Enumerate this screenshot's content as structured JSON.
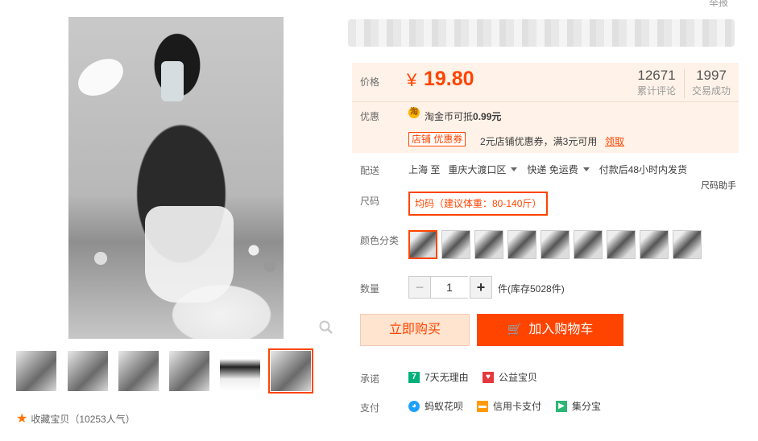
{
  "header": {
    "report": "举报"
  },
  "product": {
    "price_label": "价格",
    "currency": "¥",
    "price": "19.80",
    "stats": [
      {
        "count": "12671",
        "label": "累计评论"
      },
      {
        "count": "1997",
        "label": "交易成功"
      }
    ],
    "promo_label": "优惠",
    "coin_icon_text": "淘",
    "coin_text_prefix": "淘金币可抵",
    "coin_amount": "0.99元",
    "coupon_tag": "店铺 优惠券",
    "coupon_text": "2元店铺优惠券，满3元可用",
    "coupon_link": "领取",
    "ship_label": "配送",
    "ship_from": "上海 至",
    "ship_to": "重庆大渡口区",
    "ship_method": "快递 免运费",
    "ship_time": "付款后48小时内发货",
    "size_helper": "尺码助手",
    "size_label": "尺码",
    "size_option": "均码（建议体重：80-140斤）",
    "color_label": "颜色分类",
    "color_count": 9,
    "color_selected": 0,
    "qty_label": "数量",
    "qty_minus": "−",
    "qty_value": "1",
    "qty_plus": "+",
    "stock": "件(库存5028件)",
    "buy_now": "立即购买",
    "add_to_cart": "加入购物车",
    "promise_label": "承诺",
    "promises": [
      {
        "icon": "seven-day-icon",
        "color": "#00b07b",
        "glyph": "7",
        "text": "7天无理由"
      },
      {
        "icon": "charity-icon",
        "color": "#e4393c",
        "glyph": "♥",
        "text": "公益宝贝"
      }
    ],
    "pay_label": "支付",
    "payments": [
      {
        "icon": "huabei-icon",
        "color": "#1ea0ff",
        "glyph": "◕",
        "text": "蚂蚁花呗"
      },
      {
        "icon": "credit-card-icon",
        "color": "#ff9a00",
        "glyph": "▬",
        "text": "信用卡支付"
      },
      {
        "icon": "jifenbao-icon",
        "color": "#2bb673",
        "glyph": "▶",
        "text": "集分宝"
      }
    ]
  },
  "gallery": {
    "thumb_count": 6,
    "active_thumb": 5,
    "favorite": "收藏宝贝（10253人气）"
  },
  "colors": {
    "accent": "#ff4400",
    "price_bg": "#fff2e8"
  }
}
